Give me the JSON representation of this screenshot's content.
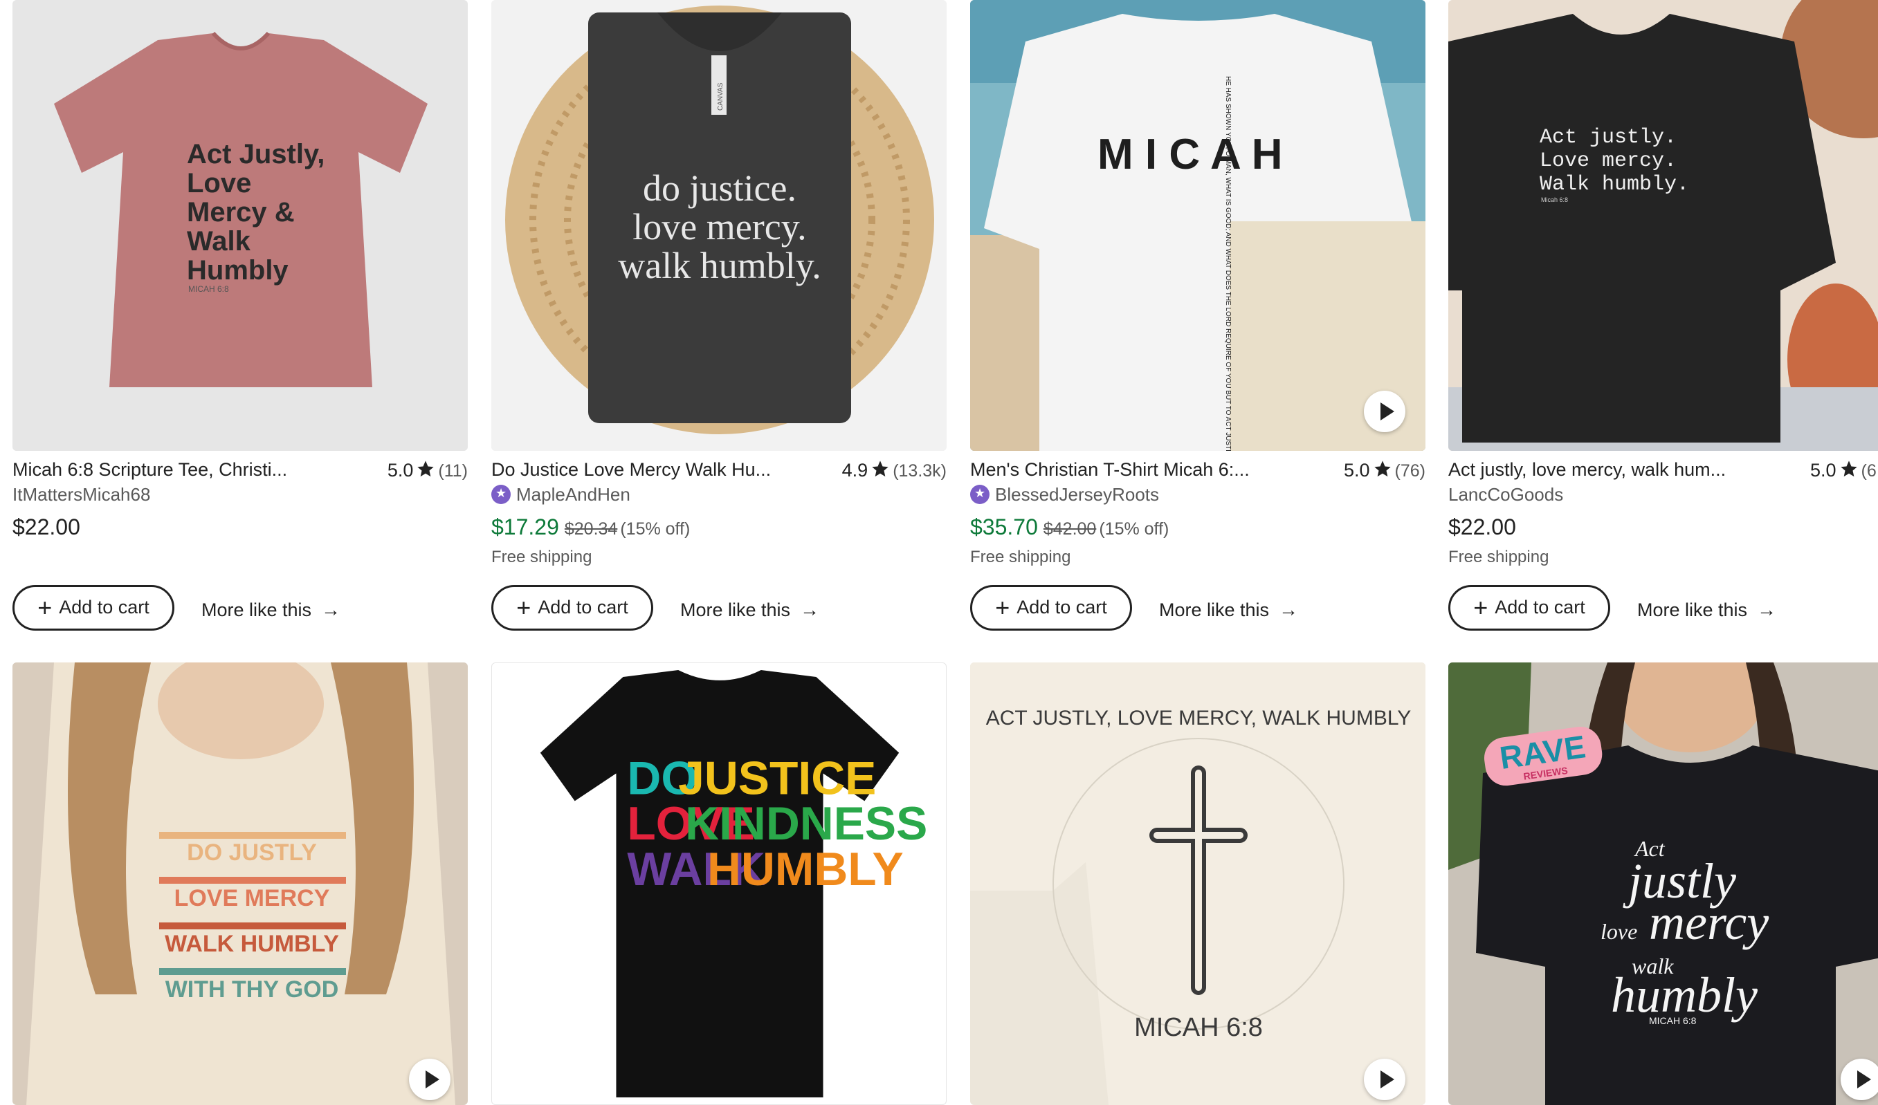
{
  "products": [
    {
      "title": "Micah 6:8 Scripture Tee, Christi...",
      "rating": "5.0",
      "review_count": "(11)",
      "shop": "ItMattersMicah68",
      "star_seller": false,
      "price": "$22.00",
      "original_price": "",
      "discount": "",
      "shipping": "",
      "add_to_cart": "Add to cart",
      "more_like_this": "More like this",
      "image": {
        "background": "#e6e6e6",
        "shirt_color": "#bd7a7a",
        "print_color": "#2a2a2a",
        "lines": [
          "Act Justly,",
          "Love",
          "Mercy &",
          "Walk",
          "Humbly"
        ],
        "sub": "MICAH 6:8"
      }
    },
    {
      "title": "Do Justice Love Mercy Walk Hu...",
      "rating": "4.9",
      "review_count": "(13.3k)",
      "shop": "MapleAndHen",
      "star_seller": true,
      "price": "$17.29",
      "original_price": "$20.34",
      "discount": "(15% off)",
      "shipping": "Free shipping",
      "add_to_cart": "Add to cart",
      "more_like_this": "More like this",
      "image": {
        "background": "#f2f2f2",
        "shirt_color": "#3b3b3b",
        "print_color": "#e8e8e8",
        "tag": "CANVAS",
        "lines": [
          "do justice.",
          "love mercy.",
          "walk humbly."
        ]
      }
    },
    {
      "title": "Men's Christian T-Shirt Micah 6:...",
      "rating": "5.0",
      "review_count": "(76)",
      "shop": "BlessedJerseyRoots",
      "star_seller": true,
      "price": "$35.70",
      "original_price": "$42.00",
      "discount": "(15% off)",
      "shipping": "Free shipping",
      "add_to_cart": "Add to cart",
      "more_like_this": "More like this",
      "image": {
        "background": "#7fb7c6",
        "shirt_color": "#f4f4f4",
        "print_color": "#1e1e1e",
        "lines": [
          "M I C A H"
        ],
        "vertical": "HE HAS SHOWN YOU, O MAN, WHAT IS GOOD; AND WHAT DOES THE LORD REQUIRE OF YOU BUT TO ACT JUSTLY AND TO LOVE MERCY AND TO WALK HUMBLY WITH YOUR GOD."
      }
    },
    {
      "title": "Act justly, love mercy, walk hum...",
      "rating": "5.0",
      "review_count": "(6",
      "shop": "LancCoGoods",
      "star_seller": false,
      "price": "$22.00",
      "original_price": "",
      "discount": "",
      "shipping": "Free shipping",
      "add_to_cart": "Add to cart",
      "more_like_this": "More like this",
      "image": {
        "background": "#e9ddd0",
        "shirt_color": "#242424",
        "print_color": "#f0f0f0",
        "lines": [
          "Act justly.",
          "Love mercy.",
          "Walk humbly."
        ],
        "sub": "Micah 6:8"
      }
    },
    {
      "image": {
        "background": "#d9ccbd",
        "shirt_color": "#efe4d2",
        "lines": [
          "DO JUSTLY",
          "LOVE MERCY",
          "WALK HUMBLY",
          "WITH THY GOD"
        ],
        "line_colors": [
          "#e9b47f",
          "#e07a5a",
          "#c65a3c",
          "#5f9c90"
        ]
      }
    },
    {
      "image": {
        "background": "#ffffff",
        "shirt_color": "#111111",
        "lines": [
          "DO",
          "JUSTICE",
          "LOVE",
          "KINDNESS",
          "WALK",
          "HUMBLY"
        ],
        "line_colors": [
          "#1ab8b0",
          "#f2c21c",
          "#e3223c",
          "#2aa84a",
          "#6b3fa0",
          "#f08a1c"
        ]
      }
    },
    {
      "image": {
        "background": "#ece6da",
        "shirt_color": "#f3ede2",
        "print_color": "#3a3a3a",
        "circle_text": "ACT JUSTLY, LOVE MERCY, WALK HUMBLY",
        "sub": "MICAH 6:8"
      }
    },
    {
      "image": {
        "background": "#c9c2b8",
        "shirt_color": "#1b1b1f",
        "print_color": "#f5f5f5",
        "badge_main": "RAVE",
        "badge_sub": "REVIEWS",
        "lines": [
          "Act",
          "justly",
          "love",
          "mercy",
          "walk",
          "humbly"
        ],
        "sub": "MICAH 6:8"
      }
    }
  ]
}
